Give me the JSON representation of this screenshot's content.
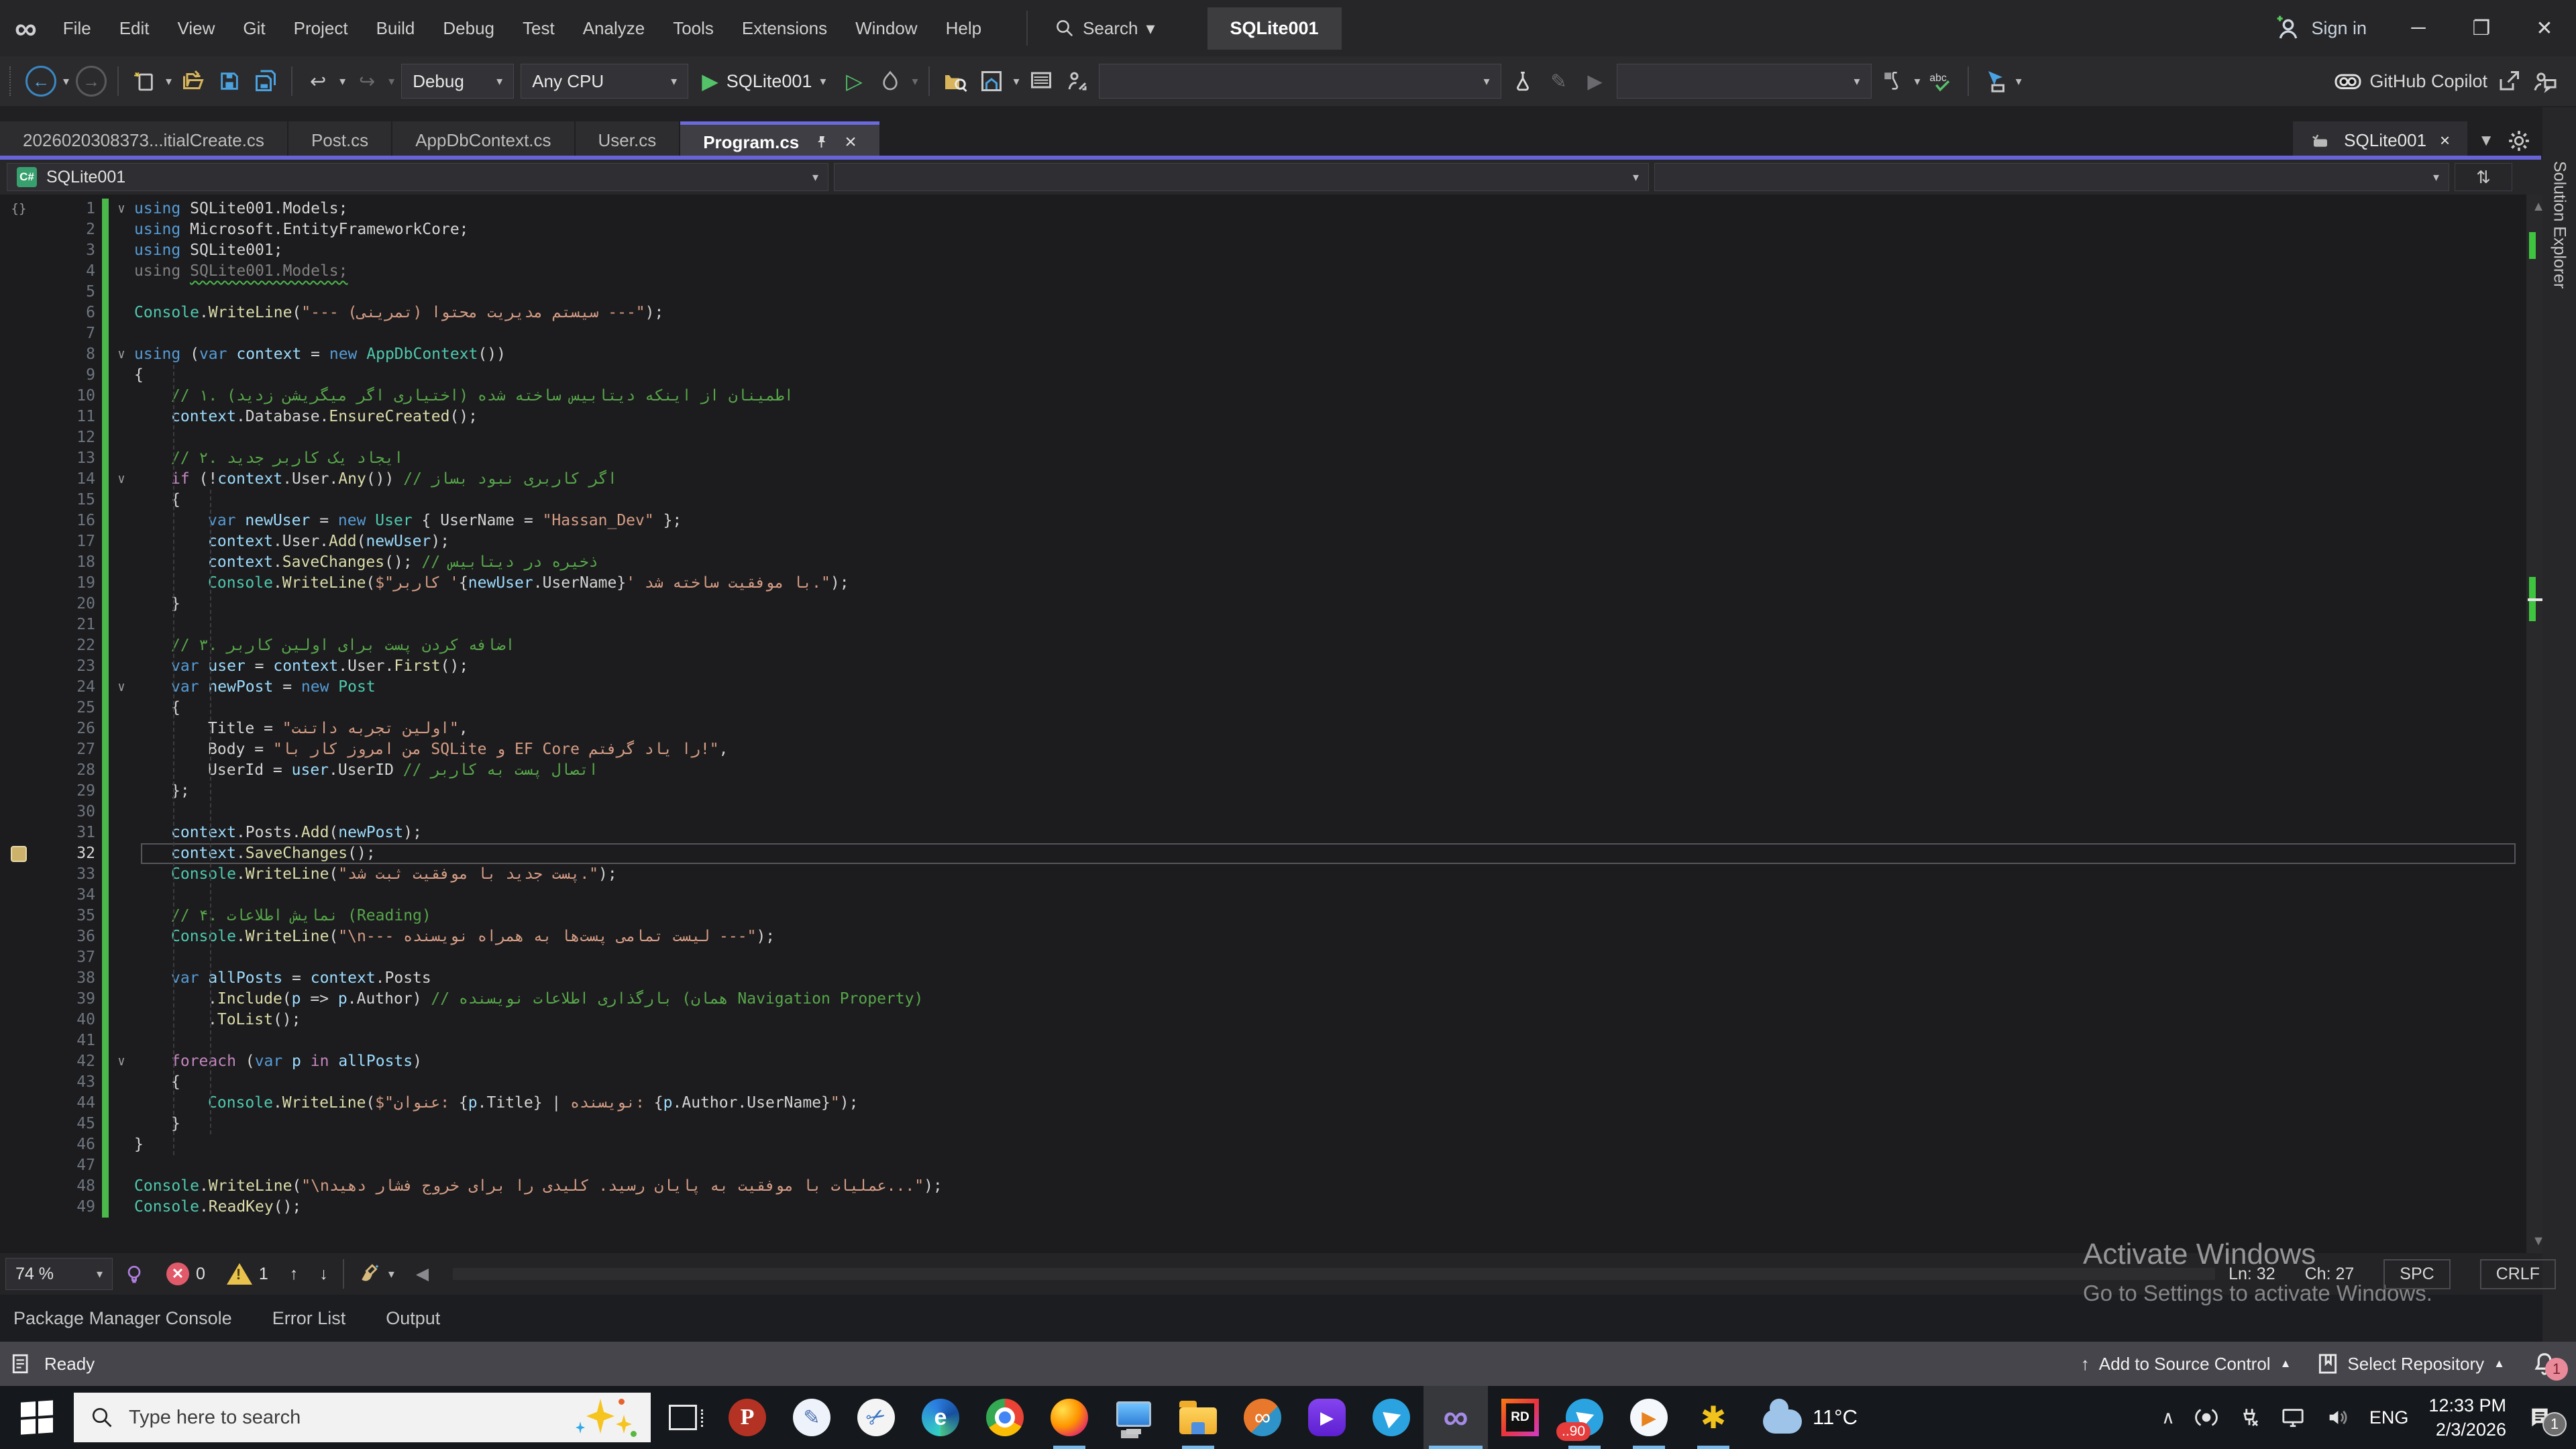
{
  "window": {
    "title": "SQLite001",
    "signin": "Sign in",
    "search": "Search"
  },
  "menus": [
    "File",
    "Edit",
    "View",
    "Git",
    "Project",
    "Build",
    "Debug",
    "Test",
    "Analyze",
    "Tools",
    "Extensions",
    "Window",
    "Help"
  ],
  "toolbar": {
    "config": "Debug",
    "platform": "Any CPU",
    "run_target": "SQLite001",
    "copilot": "GitHub Copilot"
  },
  "tabs": [
    {
      "label": "2026020308373...itialCreate.cs",
      "active": false
    },
    {
      "label": "Post.cs",
      "active": false
    },
    {
      "label": "AppDbContext.cs",
      "active": false
    },
    {
      "label": "User.cs",
      "active": false
    },
    {
      "label": "Program.cs",
      "active": true
    }
  ],
  "right_tab": {
    "label": "SQLite001"
  },
  "right_panel": {
    "label": "Solution Explorer"
  },
  "navbar": {
    "project": "SQLite001"
  },
  "editor_status": {
    "zoom": "74 %",
    "errors": "0",
    "warnings": "1",
    "ln": "Ln: 32",
    "ch": "Ch: 27",
    "spc": "SPC",
    "eol": "CRLF"
  },
  "panel_tabs": [
    "Package Manager Console",
    "Error List",
    "Output"
  ],
  "statusbar": {
    "ready": "Ready",
    "source_control": "Add to Source Control",
    "repository": "Select Repository",
    "bell_badge": "1"
  },
  "watermark": {
    "line1": "Activate Windows",
    "line2": "Go to Settings to activate Windows."
  },
  "taskbar": {
    "search_placeholder": "Type here to search",
    "weather": "11°C",
    "language": "ENG",
    "time": "12:33 PM",
    "date": "2/3/2026",
    "tray_badge": "1",
    "items": [
      {
        "name": "psiphon-icon",
        "cls": "tb-p",
        "glyph": "P"
      },
      {
        "name": "paint-icon",
        "cls": "tb-paint",
        "glyph": "✎"
      },
      {
        "name": "snipping-tool-icon",
        "cls": "tb-snip",
        "glyph": "✂"
      },
      {
        "name": "edge-icon",
        "cls": "tb-edge",
        "glyph": "e"
      },
      {
        "name": "chrome-icon",
        "cls": "tb-chrome"
      },
      {
        "name": "firefox-icon",
        "cls": "tb-ff",
        "run": true
      },
      {
        "name": "this-pc-icon",
        "cls": "tb-pc"
      },
      {
        "name": "file-explorer-icon",
        "cls": "tb-folder",
        "run": true
      },
      {
        "name": "idm-icon",
        "cls": "tb-idm",
        "glyph": "∞"
      },
      {
        "name": "kmplayer-icon",
        "cls": "tb-kmp",
        "glyph": "▶"
      },
      {
        "name": "telegram-icon",
        "cls": "tb-tg"
      },
      {
        "name": "visual-studio-icon",
        "cls": "tb-vs",
        "glyph": "∞",
        "run": true,
        "active": true
      },
      {
        "name": "rider-icon",
        "cls": "tb-rd",
        "glyph": "RD"
      },
      {
        "name": "telegram-unread-icon",
        "cls": "tb-tg",
        "run": true,
        "badge": "..90"
      },
      {
        "name": "media-player-icon",
        "cls": "tb-wmp",
        "glyph": "▶",
        "run": true
      },
      {
        "name": "downloader-icon",
        "cls": "tb-fly",
        "glyph": "✱",
        "run": true
      }
    ]
  },
  "icons": {
    "search-icon": "magnifier glyph (svg circle+handle)",
    "gear-icon": "svg gear",
    "pin-icon": "svg pin",
    "close-icon": "×",
    "chevron-down-icon": "▾",
    "undo-icon": "↩",
    "redo-icon": "↪",
    "play-icon": "▶",
    "play-outline-icon": "▷",
    "fold-chevron-icon": "∨",
    "bell-icon": "svg bell",
    "up-arrow-icon": "↑",
    "down-arrow-icon": "↓",
    "left-scroll-icon": "◀",
    "minimize-icon": "─",
    "restore-icon": "❐",
    "tray-chevron-icon": "∧"
  },
  "code": {
    "lines": [
      {
        "n": 1,
        "i": 0,
        "f": true,
        "brace": true,
        "s": [
          [
            "k",
            "using"
          ],
          [
            "p",
            " SQLite001.Models;"
          ]
        ]
      },
      {
        "n": 2,
        "i": 0,
        "s": [
          [
            "k",
            "using"
          ],
          [
            "p",
            " Microsoft.EntityFrameworkCore;"
          ]
        ]
      },
      {
        "n": 3,
        "i": 0,
        "s": [
          [
            "k",
            "using"
          ],
          [
            "p",
            " SQLite001;"
          ]
        ]
      },
      {
        "n": 4,
        "i": 0,
        "s": [
          [
            "g",
            "using "
          ],
          [
            "gq",
            "SQLite001.Models;"
          ]
        ]
      },
      {
        "n": 5,
        "i": 0,
        "s": []
      },
      {
        "n": 6,
        "i": 0,
        "s": [
          [
            "t",
            "Console"
          ],
          [
            "p",
            "."
          ],
          [
            "m",
            "WriteLine"
          ],
          [
            "p",
            "("
          ],
          [
            "s",
            "\"--- سیستم مدیریت محتوا (تمرینی) ---\""
          ],
          [
            "p",
            ");"
          ]
        ]
      },
      {
        "n": 7,
        "i": 0,
        "s": []
      },
      {
        "n": 8,
        "i": 0,
        "f": true,
        "s": [
          [
            "k",
            "using"
          ],
          [
            "p",
            " ("
          ],
          [
            "k",
            "var"
          ],
          [
            "p",
            " "
          ],
          [
            "v",
            "context"
          ],
          [
            "p",
            " = "
          ],
          [
            "k",
            "new"
          ],
          [
            "p",
            " "
          ],
          [
            "t",
            "AppDbContext"
          ],
          [
            "p",
            "())"
          ]
        ]
      },
      {
        "n": 9,
        "i": 0,
        "s": [
          [
            "p",
            "{"
          ]
        ]
      },
      {
        "n": 10,
        "i": 1,
        "s": [
          [
            "cm",
            "// ۱. اطمینان از اینکه دیتابیس ساخته شده (اختیاری اگر میگریشن زدید)"
          ]
        ]
      },
      {
        "n": 11,
        "i": 1,
        "s": [
          [
            "v",
            "context"
          ],
          [
            "p",
            ".Database."
          ],
          [
            "m",
            "EnsureCreated"
          ],
          [
            "p",
            "();"
          ]
        ]
      },
      {
        "n": 12,
        "i": 1,
        "s": []
      },
      {
        "n": 13,
        "i": 1,
        "s": [
          [
            "cm",
            "// ۲. ایجاد یک کاربر جدید"
          ]
        ]
      },
      {
        "n": 14,
        "i": 1,
        "f": true,
        "s": [
          [
            "c",
            "if"
          ],
          [
            "p",
            " (!"
          ],
          [
            "v",
            "context"
          ],
          [
            "p",
            ".User."
          ],
          [
            "m",
            "Any"
          ],
          [
            "p",
            "()) "
          ],
          [
            "cm",
            "// اگر کاربری نبود بساز"
          ]
        ]
      },
      {
        "n": 15,
        "i": 1,
        "s": [
          [
            "p",
            "{"
          ]
        ]
      },
      {
        "n": 16,
        "i": 2,
        "s": [
          [
            "k",
            "var"
          ],
          [
            "p",
            " "
          ],
          [
            "v",
            "newUser"
          ],
          [
            "p",
            " = "
          ],
          [
            "k",
            "new"
          ],
          [
            "p",
            " "
          ],
          [
            "t",
            "User"
          ],
          [
            "p",
            " { UserName = "
          ],
          [
            "s",
            "\"Hassan_Dev\""
          ],
          [
            "p",
            " };"
          ]
        ]
      },
      {
        "n": 17,
        "i": 2,
        "s": [
          [
            "v",
            "context"
          ],
          [
            "p",
            ".User."
          ],
          [
            "m",
            "Add"
          ],
          [
            "p",
            "("
          ],
          [
            "v",
            "newUser"
          ],
          [
            "p",
            ");"
          ]
        ]
      },
      {
        "n": 18,
        "i": 2,
        "s": [
          [
            "v",
            "context"
          ],
          [
            "p",
            "."
          ],
          [
            "m",
            "SaveChanges"
          ],
          [
            "p",
            "(); "
          ],
          [
            "cm",
            "// ذخیره در دیتابیس"
          ]
        ]
      },
      {
        "n": 19,
        "i": 2,
        "s": [
          [
            "t",
            "Console"
          ],
          [
            "p",
            "."
          ],
          [
            "m",
            "WriteLine"
          ],
          [
            "p",
            "("
          ],
          [
            "s",
            "$\"کاربر '"
          ],
          [
            "p",
            "{"
          ],
          [
            "v",
            "newUser"
          ],
          [
            "p",
            ".UserName}"
          ],
          [
            "s",
            "' با موفقیت ساخته شد.\""
          ],
          [
            "p",
            ");"
          ]
        ]
      },
      {
        "n": 20,
        "i": 1,
        "s": [
          [
            "p",
            "}"
          ]
        ]
      },
      {
        "n": 21,
        "i": 1,
        "s": []
      },
      {
        "n": 22,
        "i": 1,
        "s": [
          [
            "cm",
            "// ۳. اضافه کردن پست برای اولین کاربر"
          ]
        ]
      },
      {
        "n": 23,
        "i": 1,
        "s": [
          [
            "k",
            "var"
          ],
          [
            "p",
            " "
          ],
          [
            "v",
            "user"
          ],
          [
            "p",
            " = "
          ],
          [
            "v",
            "context"
          ],
          [
            "p",
            ".User."
          ],
          [
            "m",
            "First"
          ],
          [
            "p",
            "();"
          ]
        ]
      },
      {
        "n": 24,
        "i": 1,
        "f": true,
        "s": [
          [
            "k",
            "var"
          ],
          [
            "p",
            " "
          ],
          [
            "v",
            "newPost"
          ],
          [
            "p",
            " = "
          ],
          [
            "k",
            "new"
          ],
          [
            "p",
            " "
          ],
          [
            "t",
            "Post"
          ]
        ]
      },
      {
        "n": 25,
        "i": 1,
        "s": [
          [
            "p",
            "{"
          ]
        ]
      },
      {
        "n": 26,
        "i": 2,
        "s": [
          [
            "p",
            "Title = "
          ],
          [
            "s",
            "\"اولین تجربه داتنت\""
          ],
          [
            "p",
            ","
          ]
        ]
      },
      {
        "n": 27,
        "i": 2,
        "s": [
          [
            "p",
            "Body = "
          ],
          [
            "s",
            "\"من امروز کار با SQLite و EF Core را یاد گرفتم!\""
          ],
          [
            "p",
            ","
          ]
        ]
      },
      {
        "n": 28,
        "i": 2,
        "s": [
          [
            "p",
            "UserId = "
          ],
          [
            "v",
            "user"
          ],
          [
            "p",
            ".UserID "
          ],
          [
            "cm",
            "// اتصال پست به کاربر"
          ]
        ]
      },
      {
        "n": 29,
        "i": 1,
        "s": [
          [
            "p",
            "};"
          ]
        ]
      },
      {
        "n": 30,
        "i": 1,
        "s": []
      },
      {
        "n": 31,
        "i": 1,
        "s": [
          [
            "v",
            "context"
          ],
          [
            "p",
            ".Posts."
          ],
          [
            "m",
            "Add"
          ],
          [
            "p",
            "("
          ],
          [
            "v",
            "newPost"
          ],
          [
            "p",
            ");"
          ]
        ]
      },
      {
        "n": 32,
        "i": 1,
        "cur": true,
        "bm": true,
        "s": [
          [
            "v",
            "context"
          ],
          [
            "p",
            "."
          ],
          [
            "m",
            "SaveChanges"
          ],
          [
            "p",
            "();"
          ]
        ]
      },
      {
        "n": 33,
        "i": 1,
        "s": [
          [
            "t",
            "Console"
          ],
          [
            "p",
            "."
          ],
          [
            "m",
            "WriteLine"
          ],
          [
            "p",
            "("
          ],
          [
            "s",
            "\"پست جدید با موفقیت ثبت شد.\""
          ],
          [
            "p",
            ");"
          ]
        ]
      },
      {
        "n": 34,
        "i": 1,
        "s": []
      },
      {
        "n": 35,
        "i": 1,
        "s": [
          [
            "cm",
            "// ۴. نمایش اطلاعات (Reading)"
          ]
        ]
      },
      {
        "n": 36,
        "i": 1,
        "s": [
          [
            "t",
            "Console"
          ],
          [
            "p",
            "."
          ],
          [
            "m",
            "WriteLine"
          ],
          [
            "p",
            "("
          ],
          [
            "s",
            "\"\\n--- لیست تمامی پست‌ها به همراه نویسنده ---\""
          ],
          [
            "p",
            ");"
          ]
        ]
      },
      {
        "n": 37,
        "i": 1,
        "s": []
      },
      {
        "n": 38,
        "i": 1,
        "s": [
          [
            "k",
            "var"
          ],
          [
            "p",
            " "
          ],
          [
            "v",
            "allPosts"
          ],
          [
            "p",
            " = "
          ],
          [
            "v",
            "context"
          ],
          [
            "p",
            ".Posts"
          ]
        ]
      },
      {
        "n": 39,
        "i": 2,
        "s": [
          [
            "p",
            "."
          ],
          [
            "m",
            "Include"
          ],
          [
            "p",
            "("
          ],
          [
            "v",
            "p"
          ],
          [
            "p",
            " => "
          ],
          [
            "v",
            "p"
          ],
          [
            "p",
            ".Author) "
          ],
          [
            "cm",
            "// بارگذاری اطلاعات نویسنده (همان Navigation Property)"
          ]
        ]
      },
      {
        "n": 40,
        "i": 2,
        "s": [
          [
            "p",
            "."
          ],
          [
            "m",
            "ToList"
          ],
          [
            "p",
            "();"
          ]
        ]
      },
      {
        "n": 41,
        "i": 1,
        "s": []
      },
      {
        "n": 42,
        "i": 1,
        "f": true,
        "s": [
          [
            "c",
            "foreach"
          ],
          [
            "p",
            " ("
          ],
          [
            "k",
            "var"
          ],
          [
            "p",
            " "
          ],
          [
            "v",
            "p"
          ],
          [
            "p",
            " "
          ],
          [
            "c",
            "in"
          ],
          [
            "p",
            " "
          ],
          [
            "v",
            "allPosts"
          ],
          [
            "p",
            ")"
          ]
        ]
      },
      {
        "n": 43,
        "i": 1,
        "s": [
          [
            "p",
            "{"
          ]
        ]
      },
      {
        "n": 44,
        "i": 2,
        "s": [
          [
            "t",
            "Console"
          ],
          [
            "p",
            "."
          ],
          [
            "m",
            "WriteLine"
          ],
          [
            "p",
            "("
          ],
          [
            "s",
            "$\"عنوان: "
          ],
          [
            "p",
            "{"
          ],
          [
            "v",
            "p"
          ],
          [
            "p",
            ".Title} | "
          ],
          [
            "s",
            "نویسنده: "
          ],
          [
            "p",
            "{"
          ],
          [
            "v",
            "p"
          ],
          [
            "p",
            ".Author.UserName}"
          ],
          [
            "s",
            "\""
          ],
          [
            "p",
            ");"
          ]
        ]
      },
      {
        "n": 45,
        "i": 1,
        "s": [
          [
            "p",
            "}"
          ]
        ]
      },
      {
        "n": 46,
        "i": 0,
        "s": [
          [
            "p",
            "}"
          ]
        ]
      },
      {
        "n": 47,
        "i": 0,
        "s": []
      },
      {
        "n": 48,
        "i": 0,
        "s": [
          [
            "t",
            "Console"
          ],
          [
            "p",
            "."
          ],
          [
            "m",
            "WriteLine"
          ],
          [
            "p",
            "("
          ],
          [
            "s",
            "\"\\nعملیات با موفقیت به پایان رسید. کلیدی را برای خروج فشار دهید...\""
          ],
          [
            "p",
            ");"
          ]
        ]
      },
      {
        "n": 49,
        "i": 0,
        "s": [
          [
            "t",
            "Console"
          ],
          [
            "p",
            "."
          ],
          [
            "m",
            "ReadKey"
          ],
          [
            "p",
            "();"
          ]
        ]
      }
    ]
  }
}
